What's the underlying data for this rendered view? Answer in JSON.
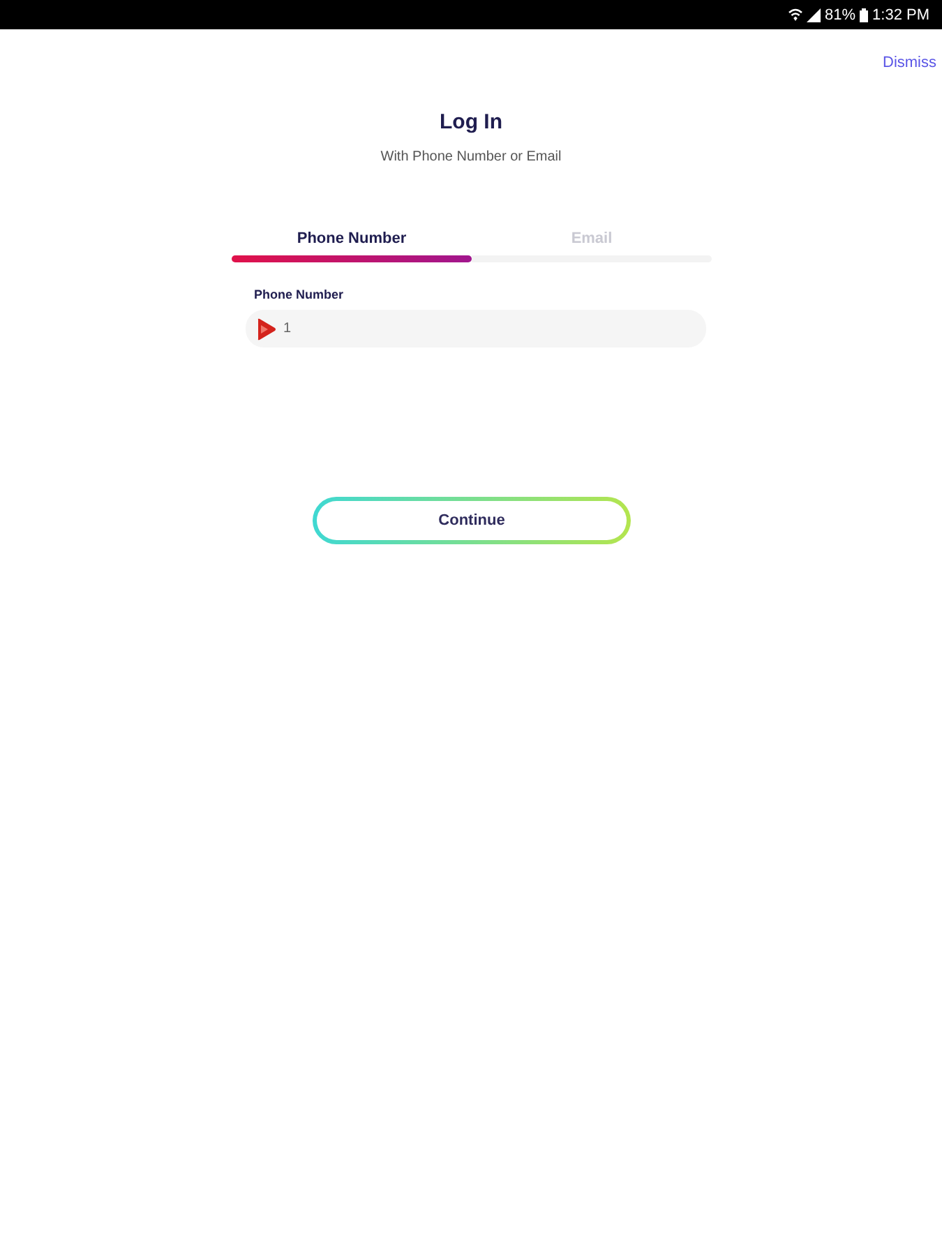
{
  "status_bar": {
    "battery": "81%",
    "time": "1:32 PM"
  },
  "dismiss": "Dismiss",
  "title": "Log In",
  "subtitle": "With Phone Number or Email",
  "tabs": [
    {
      "label": "Phone Number",
      "selected": true
    },
    {
      "label": "Email",
      "selected": false
    }
  ],
  "phone_field": {
    "label": "Phone Number",
    "value": "1"
  },
  "continue_button": "Continue"
}
